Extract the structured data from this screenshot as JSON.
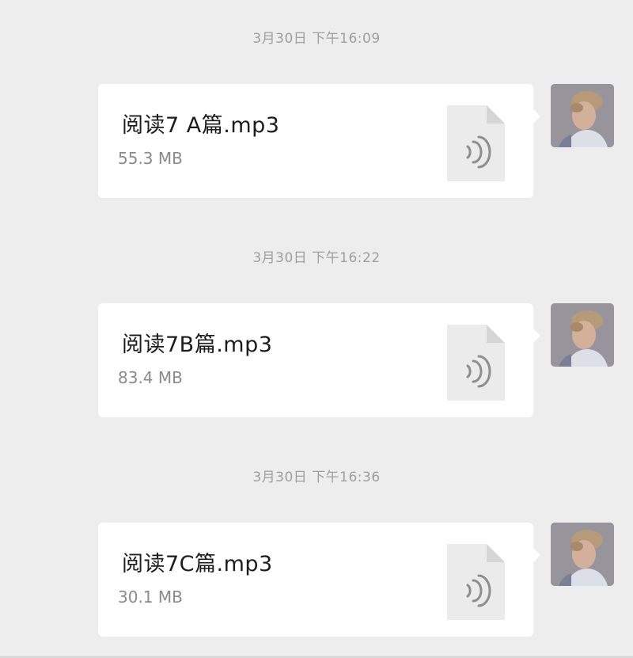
{
  "messages": [
    {
      "timestamp": "3月30日 下午16:09",
      "file_name": "阅读7 A篇.mp3",
      "file_size": "55.3 MB",
      "file_icon": "audio-file-icon"
    },
    {
      "timestamp": "3月30日 下午16:22",
      "file_name": "阅读7B篇.mp3",
      "file_size": "83.4 MB",
      "file_icon": "audio-file-icon"
    },
    {
      "timestamp": "3月30日 下午16:36",
      "file_name": "阅读7C篇.mp3",
      "file_size": "30.1 MB",
      "file_icon": "audio-file-icon"
    }
  ],
  "colors": {
    "background": "#ededed",
    "bubble": "#ffffff",
    "timestamp_text": "#9e9e9e",
    "file_size_text": "#8a8a8a",
    "file_icon": "#ebebeb"
  }
}
